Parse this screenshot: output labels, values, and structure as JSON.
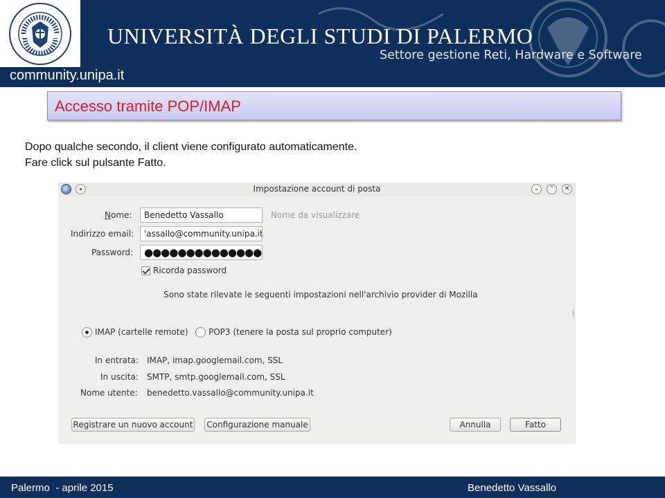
{
  "header": {
    "university": "UNIVERSITÀ DEGLI STUDI DI PALERMO",
    "department": "Settore gestione Reti, Hardware e Software",
    "site": "community.unipa.it",
    "seal_icon": "university-seal-icon"
  },
  "slide": {
    "title": "Accesso tramite POP/IMAP",
    "line1": "Dopo qualche secondo, il client viene configurato automaticamente.",
    "line2": "Fare click sul pulsante Fatto."
  },
  "dialog": {
    "title": "Impostazione account di posta",
    "name_label": "Nome:",
    "name_value": "Benedetto Vassallo",
    "name_hint": "Nome da visualizzare",
    "email_label": "Indirizzo email:",
    "email_value": "'assallo@community.unipa.it",
    "password_label": "Password:",
    "password_value": "●●●●●●●●●●●●●●●●",
    "remember_label": "Ricorda password",
    "remember_checked": true,
    "detected_text": "Sono state rilevate le seguenti impostazioni nell'archivio provider di Mozilla",
    "imap_label": "IMAP (cartelle remote)",
    "pop3_label": "POP3 (tenere la posta sul proprio computer)",
    "selected_protocol": "IMAP",
    "incoming_label": "In entrata:",
    "incoming_value": "IMAP, imap.googlemail.com, SSL",
    "outgoing_label": "In uscita:",
    "outgoing_value": "SMTP, smtp.googlemail.com, SSL",
    "username_label": "Nome utente:",
    "username_value": "benedetto.vassallo@community.unipa.it",
    "register_button": "Registrare un nuovo account",
    "manual_button": "Configurazione manuale",
    "cancel_button": "Annulla",
    "done_button": "Fatto"
  },
  "footer": {
    "left": "Palermo  - aprile 2015",
    "right": "Benedetto Vassallo"
  },
  "colors": {
    "header_blue": "#0e2f5c",
    "title_red": "#d4202a",
    "title_box": "#d3d3f5"
  }
}
